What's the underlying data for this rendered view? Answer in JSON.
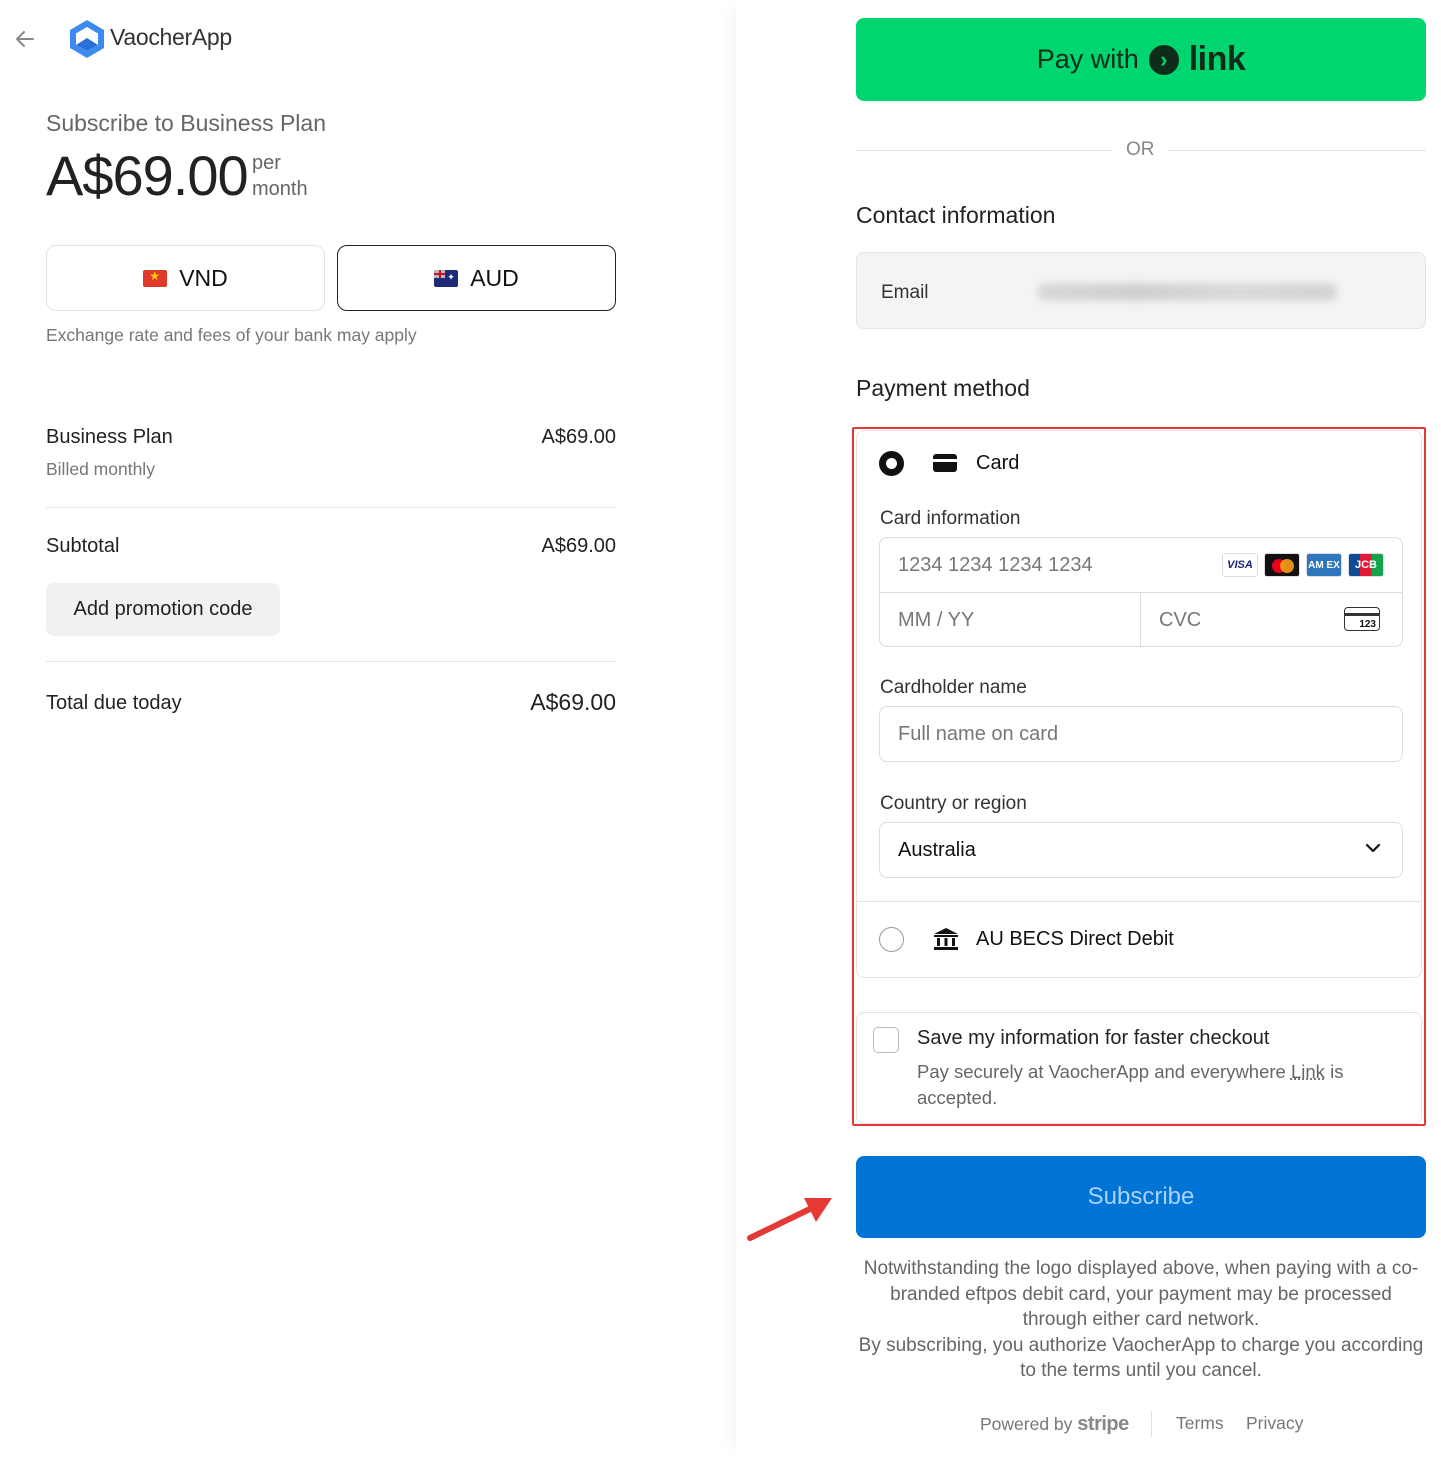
{
  "header": {
    "back_icon": "arrow-left-icon",
    "brand_name": "VaocherApp"
  },
  "summary": {
    "subscribe_title": "Subscribe to Business Plan",
    "price": "A$69.00",
    "per_line1": "per",
    "per_line2": "month",
    "currencies": [
      {
        "code": "VND",
        "selected": false
      },
      {
        "code": "AUD",
        "selected": true
      }
    ],
    "exchange_note": "Exchange rate and fees of your bank may apply",
    "line_item": {
      "name": "Business Plan",
      "billing": "Billed monthly",
      "amount": "A$69.00"
    },
    "subtotal_label": "Subtotal",
    "subtotal_amount": "A$69.00",
    "promo_label": "Add promotion code",
    "total_label": "Total due today",
    "total_amount": "A$69.00"
  },
  "checkout": {
    "pay_with_label": "Pay with",
    "link_word": "link",
    "or_text": "OR",
    "contact_heading": "Contact information",
    "email_label": "Email",
    "payment_heading": "Payment method",
    "methods": [
      {
        "label": "Card",
        "selected": true,
        "icon": "credit-card-icon"
      },
      {
        "label": "AU BECS Direct Debit",
        "selected": false,
        "icon": "bank-icon"
      }
    ],
    "card_info_label": "Card information",
    "card_number_placeholder": "1234 1234 1234 1234",
    "expiry_placeholder": "MM / YY",
    "cvc_placeholder": "CVC",
    "cvc_icon_text": "123",
    "card_brands": [
      "VISA",
      "",
      "AM EX",
      "JCB"
    ],
    "cardholder_label": "Cardholder name",
    "cardholder_placeholder": "Full name on card",
    "country_label": "Country or region",
    "country_value": "Australia",
    "save_title": "Save my information for faster checkout",
    "save_desc_prefix": "Pay securely at VaocherApp and everywhere ",
    "save_desc_link": "Link",
    "save_desc_suffix": " is accepted.",
    "subscribe_label": "Subscribe",
    "legal_line1": "Notwithstanding the logo displayed above, when paying with a co-branded eftpos debit card, your payment may be processed through either card network.",
    "legal_line2": "By subscribing, you authorize VaocherApp to charge you according to the terms until you cancel.",
    "powered_by": "Powered by",
    "stripe_word": "stripe",
    "terms": "Terms",
    "privacy": "Privacy"
  },
  "colors": {
    "link_green": "#00d66f",
    "subscribe_blue": "#0074d4",
    "highlight_red": "#e53935"
  }
}
